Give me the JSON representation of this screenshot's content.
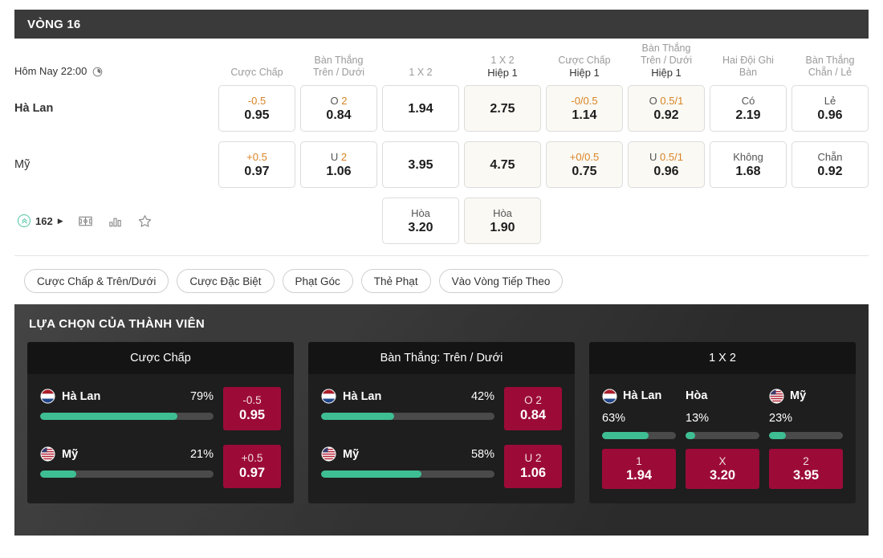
{
  "round": {
    "title": "VÒNG 16"
  },
  "match": {
    "kickoff": "Hôm Nay 22:00",
    "clock_icon": "clock-icon",
    "home_team": "Hà Lan",
    "away_team": "Mỹ",
    "draw_label": "Hòa",
    "live_count": "162",
    "live_icon": "chevrons-up-icon",
    "live_arrow": "▶",
    "pitch_icon": "football-pitch-icon",
    "stats_icon": "bar-chart-icon",
    "favorite_icon": "star-icon"
  },
  "columns": [
    {
      "title": "Cược Chấp",
      "sub": "",
      "half1": false
    },
    {
      "title": "Bàn Thắng\nTrên / Dưới",
      "sub": "",
      "half1": false
    },
    {
      "title": "1 X 2",
      "sub": "",
      "half1": false
    },
    {
      "title": "1 X 2",
      "sub": "Hiệp 1",
      "half1": true
    },
    {
      "title": "Cược Chấp",
      "sub": "Hiệp 1",
      "half1": true
    },
    {
      "title": "Bàn Thắng\nTrên / Dưới",
      "sub": "Hiệp 1",
      "half1": true
    },
    {
      "title": "Hai Đội Ghi\nBàn",
      "sub": "",
      "half1": false
    },
    {
      "title": "Bàn Thắng\nChẵn / Lẻ",
      "sub": "",
      "half1": false
    }
  ],
  "rows": {
    "home": [
      {
        "line": "-0.5",
        "line_orange": true,
        "price": "0.95",
        "half1": false
      },
      {
        "line": "O",
        "hc": "2",
        "price": "0.84",
        "half1": false
      },
      {
        "line": "",
        "price": "1.94",
        "half1": false
      },
      {
        "line": "",
        "price": "2.75",
        "half1": true
      },
      {
        "line": "-0/0.5",
        "line_orange": true,
        "price": "1.14",
        "half1": true
      },
      {
        "line": "O",
        "hc": "0.5/1",
        "price": "0.92",
        "half1": true
      },
      {
        "line": "Có",
        "price": "2.19",
        "half1": false
      },
      {
        "line": "Lẻ",
        "price": "0.96",
        "half1": false
      }
    ],
    "away": [
      {
        "line": "+0.5",
        "line_orange": true,
        "price": "0.97",
        "half1": false
      },
      {
        "line": "U",
        "hc": "2",
        "price": "1.06",
        "half1": false
      },
      {
        "line": "",
        "price": "3.95",
        "half1": false
      },
      {
        "line": "",
        "price": "4.75",
        "half1": true
      },
      {
        "line": "+0/0.5",
        "line_orange": true,
        "price": "0.75",
        "half1": true
      },
      {
        "line": "U",
        "hc": "0.5/1",
        "price": "0.96",
        "half1": true
      },
      {
        "line": "Không",
        "price": "1.68",
        "half1": false
      },
      {
        "line": "Chẵn",
        "price": "0.92",
        "half1": false
      }
    ],
    "draw": [
      {
        "empty": true
      },
      {
        "empty": true
      },
      {
        "line": "Hòa",
        "price": "3.20",
        "half1": false
      },
      {
        "line": "Hòa",
        "price": "1.90",
        "half1": true
      },
      {
        "empty": true
      },
      {
        "empty": true
      },
      {
        "empty": true
      },
      {
        "empty": true
      }
    ]
  },
  "filters": [
    "Cược Chấp & Trên/Dưới",
    "Cược Đặc Biệt",
    "Phạt Góc",
    "Thẻ Phạt",
    "Vào Vòng Tiếp Theo"
  ],
  "member": {
    "title": "LỰA CHỌN CỦA THÀNH VIÊN",
    "cards": [
      {
        "header": "Cược Chấp",
        "layout": "two-row",
        "rows": [
          {
            "flag": "netherlands-flag",
            "name": "Hà Lan",
            "pct": "79%",
            "pct_value": 79,
            "odd_line": "-0.5",
            "odd_price": "0.95"
          },
          {
            "flag": "usa-flag",
            "name": "Mỹ",
            "pct": "21%",
            "pct_value": 21,
            "odd_line": "+0.5",
            "odd_price": "0.97"
          }
        ]
      },
      {
        "header": "Bàn Thắng: Trên / Dưới",
        "layout": "two-row",
        "rows": [
          {
            "flag": "netherlands-flag",
            "name": "Hà Lan",
            "pct": "42%",
            "pct_value": 42,
            "odd_line": "O 2",
            "odd_price": "0.84"
          },
          {
            "flag": "usa-flag",
            "name": "Mỹ",
            "pct": "58%",
            "pct_value": 58,
            "odd_line": "U 2",
            "odd_price": "1.06"
          }
        ]
      },
      {
        "header": "1 X 2",
        "layout": "three-col",
        "cols": [
          {
            "flag": "netherlands-flag",
            "name": "Hà Lan",
            "pct": "63%",
            "pct_value": 63,
            "odd_line": "1",
            "odd_price": "1.94"
          },
          {
            "flag": "none",
            "name": "Hòa",
            "pct": "13%",
            "pct_value": 13,
            "odd_line": "X",
            "odd_price": "3.20"
          },
          {
            "flag": "usa-flag",
            "name": "Mỹ",
            "pct": "23%",
            "pct_value": 23,
            "odd_line": "2",
            "odd_price": "3.95"
          }
        ]
      }
    ]
  },
  "colors": {
    "accent_teal": "#3ebe93",
    "odd_crimson": "#9c0b38",
    "handicap_orange": "#d98324",
    "dark_panel": "#2b2b2b",
    "title_bar": "#3a3a3a"
  }
}
